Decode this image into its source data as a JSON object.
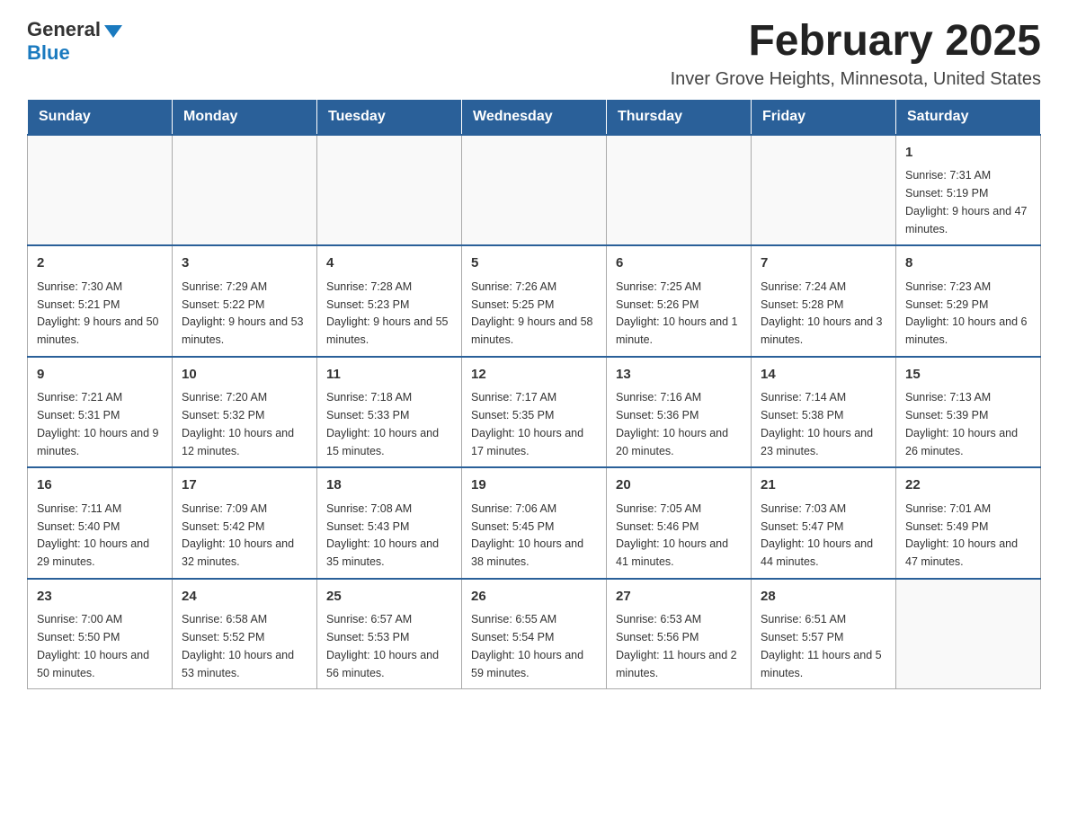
{
  "logo": {
    "general": "General",
    "blue": "Blue"
  },
  "title": "February 2025",
  "subtitle": "Inver Grove Heights, Minnesota, United States",
  "days_of_week": [
    "Sunday",
    "Monday",
    "Tuesday",
    "Wednesday",
    "Thursday",
    "Friday",
    "Saturday"
  ],
  "weeks": [
    [
      {
        "day": "",
        "info": ""
      },
      {
        "day": "",
        "info": ""
      },
      {
        "day": "",
        "info": ""
      },
      {
        "day": "",
        "info": ""
      },
      {
        "day": "",
        "info": ""
      },
      {
        "day": "",
        "info": ""
      },
      {
        "day": "1",
        "info": "Sunrise: 7:31 AM\nSunset: 5:19 PM\nDaylight: 9 hours and 47 minutes."
      }
    ],
    [
      {
        "day": "2",
        "info": "Sunrise: 7:30 AM\nSunset: 5:21 PM\nDaylight: 9 hours and 50 minutes."
      },
      {
        "day": "3",
        "info": "Sunrise: 7:29 AM\nSunset: 5:22 PM\nDaylight: 9 hours and 53 minutes."
      },
      {
        "day": "4",
        "info": "Sunrise: 7:28 AM\nSunset: 5:23 PM\nDaylight: 9 hours and 55 minutes."
      },
      {
        "day": "5",
        "info": "Sunrise: 7:26 AM\nSunset: 5:25 PM\nDaylight: 9 hours and 58 minutes."
      },
      {
        "day": "6",
        "info": "Sunrise: 7:25 AM\nSunset: 5:26 PM\nDaylight: 10 hours and 1 minute."
      },
      {
        "day": "7",
        "info": "Sunrise: 7:24 AM\nSunset: 5:28 PM\nDaylight: 10 hours and 3 minutes."
      },
      {
        "day": "8",
        "info": "Sunrise: 7:23 AM\nSunset: 5:29 PM\nDaylight: 10 hours and 6 minutes."
      }
    ],
    [
      {
        "day": "9",
        "info": "Sunrise: 7:21 AM\nSunset: 5:31 PM\nDaylight: 10 hours and 9 minutes."
      },
      {
        "day": "10",
        "info": "Sunrise: 7:20 AM\nSunset: 5:32 PM\nDaylight: 10 hours and 12 minutes."
      },
      {
        "day": "11",
        "info": "Sunrise: 7:18 AM\nSunset: 5:33 PM\nDaylight: 10 hours and 15 minutes."
      },
      {
        "day": "12",
        "info": "Sunrise: 7:17 AM\nSunset: 5:35 PM\nDaylight: 10 hours and 17 minutes."
      },
      {
        "day": "13",
        "info": "Sunrise: 7:16 AM\nSunset: 5:36 PM\nDaylight: 10 hours and 20 minutes."
      },
      {
        "day": "14",
        "info": "Sunrise: 7:14 AM\nSunset: 5:38 PM\nDaylight: 10 hours and 23 minutes."
      },
      {
        "day": "15",
        "info": "Sunrise: 7:13 AM\nSunset: 5:39 PM\nDaylight: 10 hours and 26 minutes."
      }
    ],
    [
      {
        "day": "16",
        "info": "Sunrise: 7:11 AM\nSunset: 5:40 PM\nDaylight: 10 hours and 29 minutes."
      },
      {
        "day": "17",
        "info": "Sunrise: 7:09 AM\nSunset: 5:42 PM\nDaylight: 10 hours and 32 minutes."
      },
      {
        "day": "18",
        "info": "Sunrise: 7:08 AM\nSunset: 5:43 PM\nDaylight: 10 hours and 35 minutes."
      },
      {
        "day": "19",
        "info": "Sunrise: 7:06 AM\nSunset: 5:45 PM\nDaylight: 10 hours and 38 minutes."
      },
      {
        "day": "20",
        "info": "Sunrise: 7:05 AM\nSunset: 5:46 PM\nDaylight: 10 hours and 41 minutes."
      },
      {
        "day": "21",
        "info": "Sunrise: 7:03 AM\nSunset: 5:47 PM\nDaylight: 10 hours and 44 minutes."
      },
      {
        "day": "22",
        "info": "Sunrise: 7:01 AM\nSunset: 5:49 PM\nDaylight: 10 hours and 47 minutes."
      }
    ],
    [
      {
        "day": "23",
        "info": "Sunrise: 7:00 AM\nSunset: 5:50 PM\nDaylight: 10 hours and 50 minutes."
      },
      {
        "day": "24",
        "info": "Sunrise: 6:58 AM\nSunset: 5:52 PM\nDaylight: 10 hours and 53 minutes."
      },
      {
        "day": "25",
        "info": "Sunrise: 6:57 AM\nSunset: 5:53 PM\nDaylight: 10 hours and 56 minutes."
      },
      {
        "day": "26",
        "info": "Sunrise: 6:55 AM\nSunset: 5:54 PM\nDaylight: 10 hours and 59 minutes."
      },
      {
        "day": "27",
        "info": "Sunrise: 6:53 AM\nSunset: 5:56 PM\nDaylight: 11 hours and 2 minutes."
      },
      {
        "day": "28",
        "info": "Sunrise: 6:51 AM\nSunset: 5:57 PM\nDaylight: 11 hours and 5 minutes."
      },
      {
        "day": "",
        "info": ""
      }
    ]
  ]
}
